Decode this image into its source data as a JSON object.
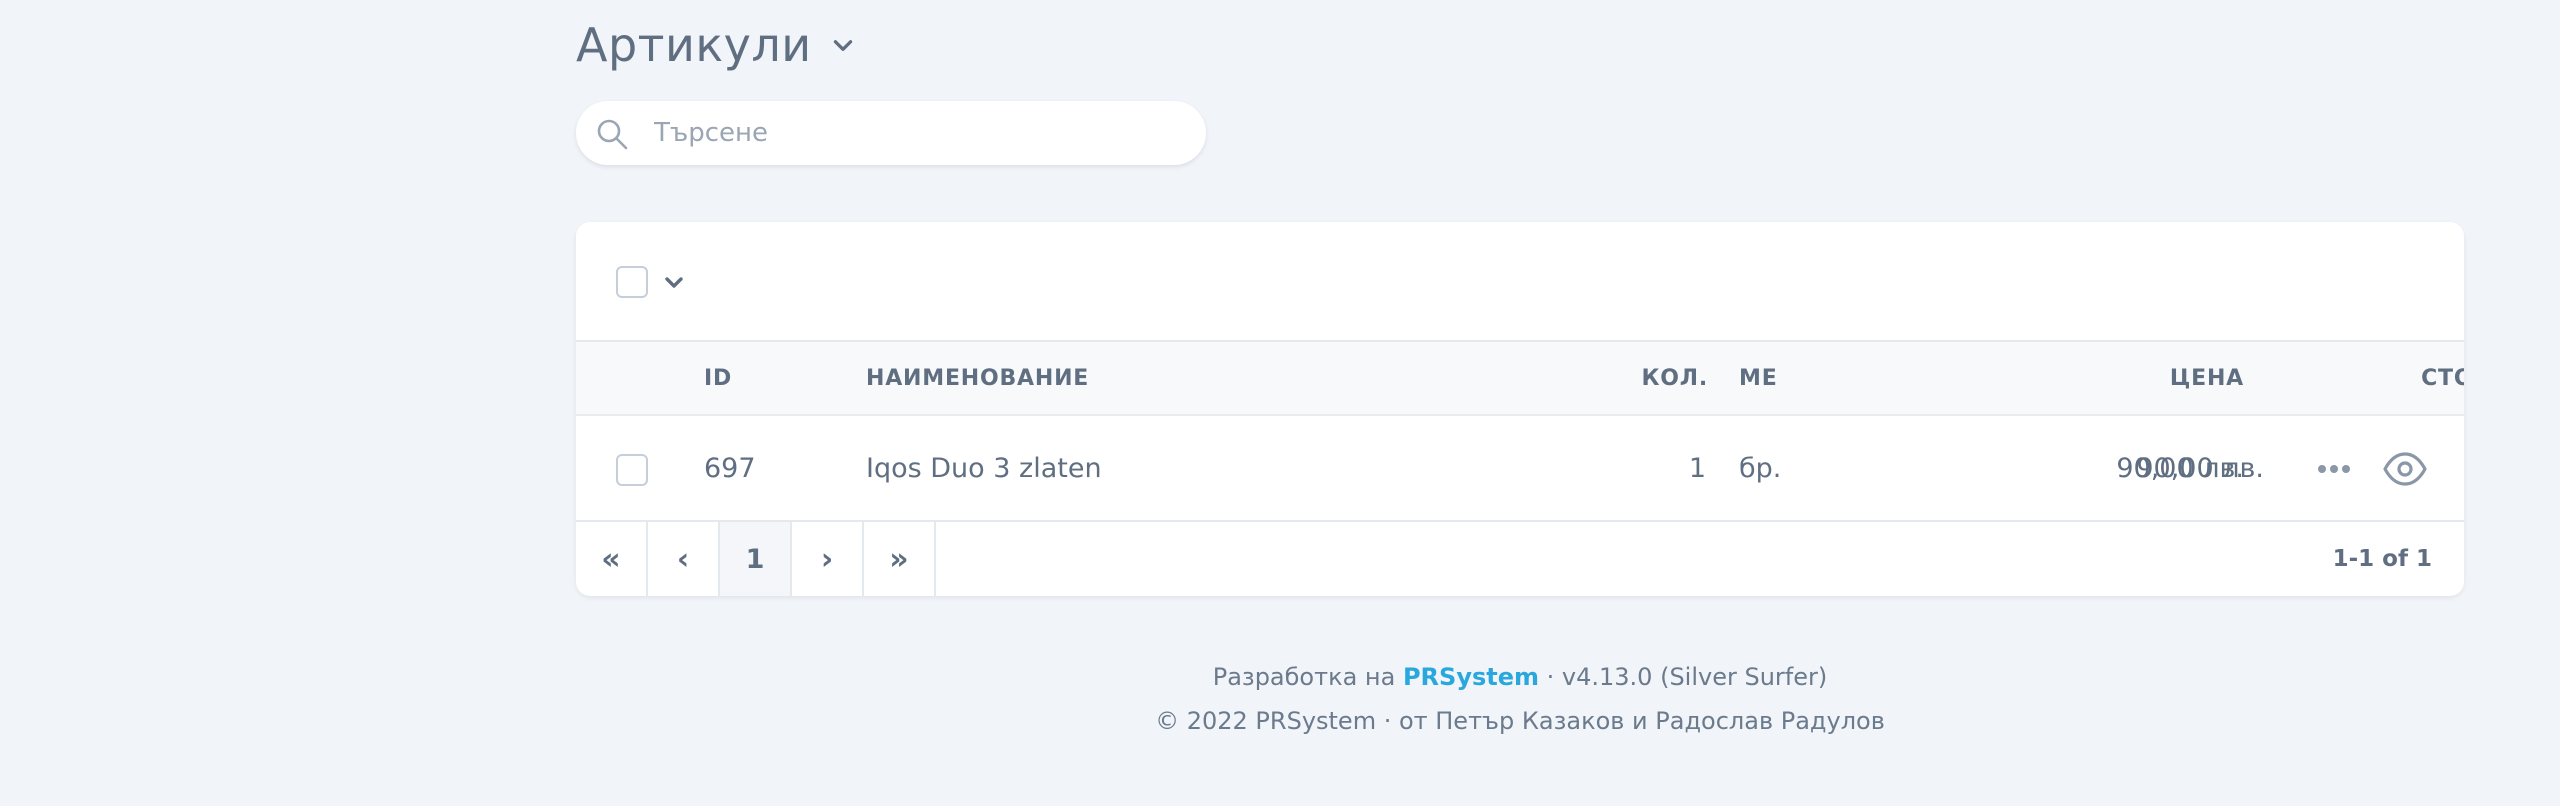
{
  "header": {
    "title": "Артикули"
  },
  "search": {
    "placeholder": "Търсене",
    "value": ""
  },
  "table": {
    "columns": {
      "id": "ID",
      "name": "НАИМЕНОВАНИЕ",
      "qty": "КОЛ.",
      "unit": "МЕ",
      "price": "ЦЕНА",
      "value": "СТОЙНОСТ"
    },
    "rows": [
      {
        "id": "697",
        "name": "Iqos Duo 3 zlaten",
        "qty": "1",
        "unit": "бр.",
        "price": "90,00 лв.",
        "value": "90,00 лв."
      }
    ]
  },
  "pagination": {
    "first": "«",
    "prev": "‹",
    "current": "1",
    "next": "›",
    "last": "»",
    "info": "1-1 of 1"
  },
  "footer": {
    "made_by": "Разработка на",
    "brand": "PRSystem",
    "version": "· v4.13.0 (Silver Surfer)",
    "copyright": "© 2022 PRSystem · от Петър Казаков и Радослав Радулов"
  },
  "colors": {
    "background": "#f1f4f9",
    "text": "#5f6e80",
    "accent": "#2aa7dc"
  }
}
